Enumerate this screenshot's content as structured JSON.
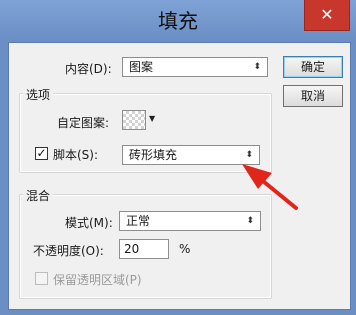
{
  "window": {
    "title": "填充",
    "close_label": "✕"
  },
  "content": {
    "label": "内容(D):",
    "value": "图案"
  },
  "buttons": {
    "ok": "确定",
    "cancel": "取消"
  },
  "options": {
    "group_title": "选项",
    "custom_pattern_label": "自定图案:",
    "script_checked": true,
    "script_label": "脚本(S):",
    "script_value": "砖形填充"
  },
  "blending": {
    "group_title": "混合",
    "mode_label": "模式(M):",
    "mode_value": "正常",
    "opacity_label": "不透明度(O):",
    "opacity_value": "20",
    "opacity_unit": "%",
    "preserve_transparency_label": "保留透明区域(P)",
    "preserve_transparency_checked": false
  },
  "colors": {
    "annotation_arrow": "#e0251b",
    "title_bar": "#6b8fc5",
    "close_button": "#c7372c"
  },
  "icons": {
    "check": "checkmark-icon",
    "dropdown": "updown-arrows-icon",
    "close": "close-icon"
  }
}
